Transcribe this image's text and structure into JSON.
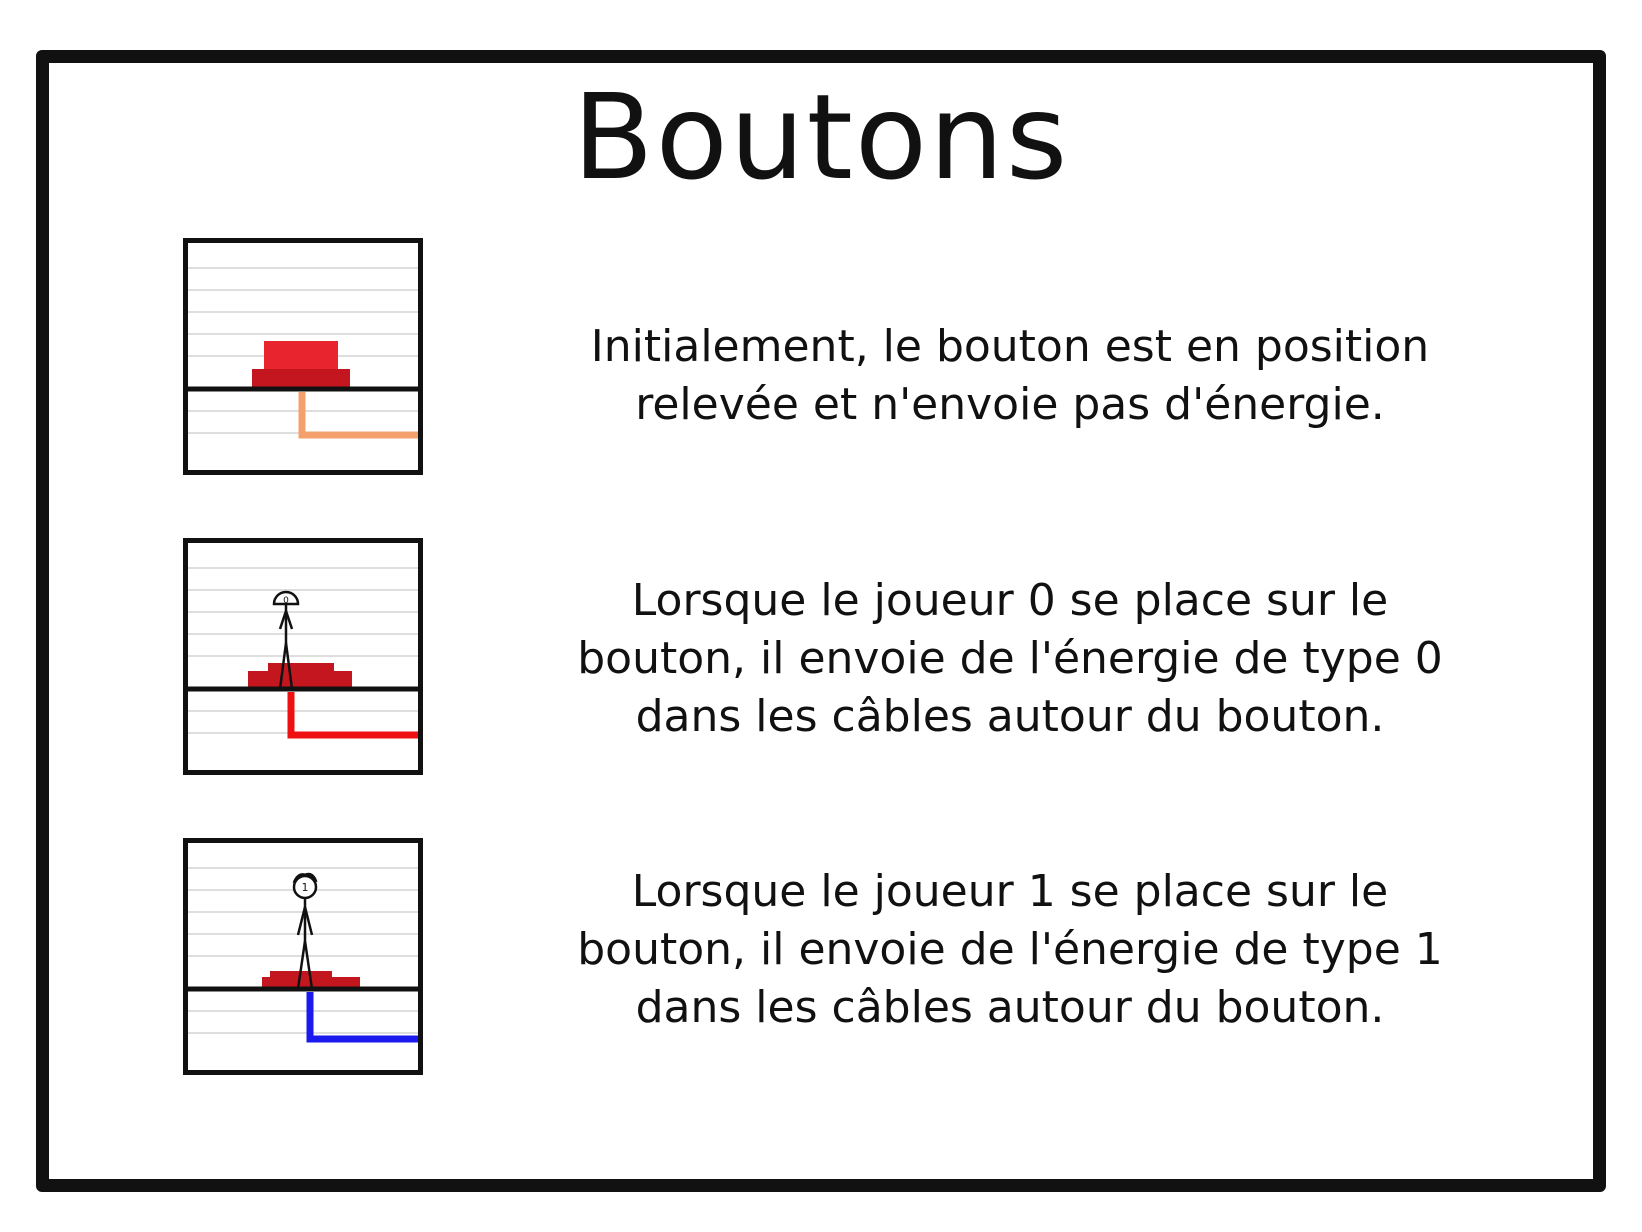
{
  "title": "Boutons",
  "rows": [
    {
      "lines": [
        "Initialement, le bouton est en position",
        "relevée et n'envoie pas d'énergie."
      ],
      "cable_color": "#f4a06c"
    },
    {
      "lines": [
        "Lorsque le joueur 0 se place sur le",
        "bouton, il envoie de l'énergie de type 0",
        "dans les câbles autour du bouton."
      ],
      "player_label": "0",
      "cable_color": "#ee1111"
    },
    {
      "lines": [
        "Lorsque le joueur 1 se place sur le",
        "bouton, il envoie de l'énergie de type 1",
        "dans les câbles autour du bouton."
      ],
      "player_label": "1",
      "cable_color": "#1a1aee"
    }
  ],
  "colors": {
    "button_light": "#e8242e",
    "button_dark": "#c4161f",
    "frame": "#111111",
    "grid_line": "#dedede"
  }
}
